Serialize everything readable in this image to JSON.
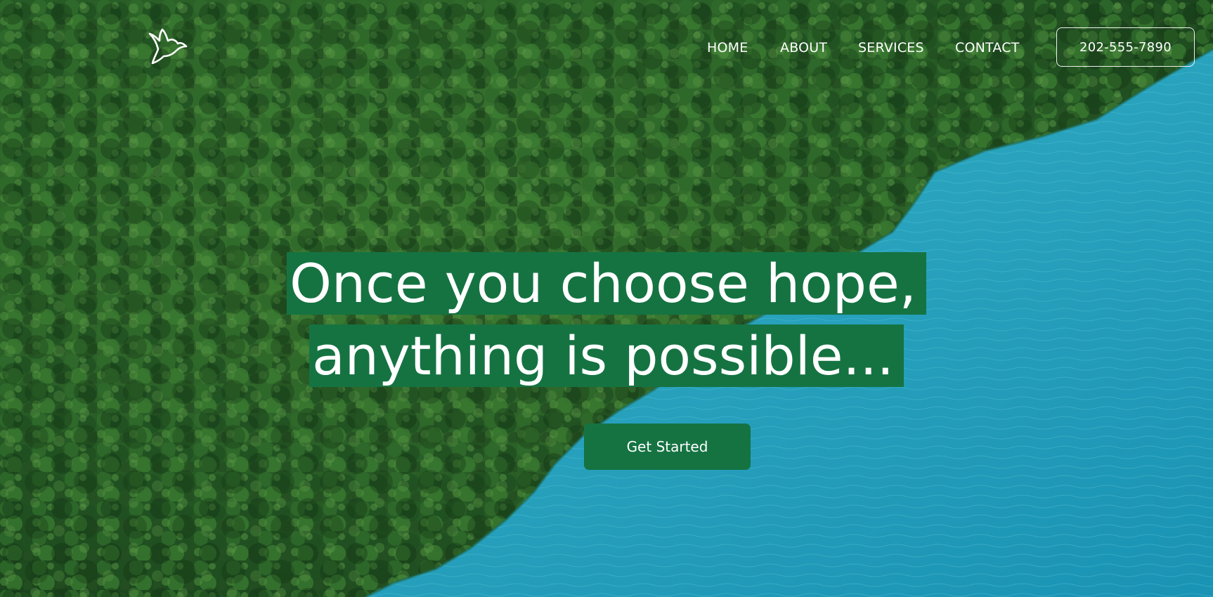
{
  "brand": {
    "logo_icon": "dove-icon",
    "accent_color": "#157342"
  },
  "nav": {
    "items": [
      {
        "label": "HOME"
      },
      {
        "label": "ABOUT"
      },
      {
        "label": "SERVICES"
      },
      {
        "label": "CONTACT"
      }
    ],
    "phone": "202-555-7890"
  },
  "hero": {
    "background": "aerial view of dense green forest meeting turquoise lake water",
    "headline_line1": "Once you choose hope,",
    "headline_line2": "anything is possible...",
    "cta_label": "Get Started"
  }
}
